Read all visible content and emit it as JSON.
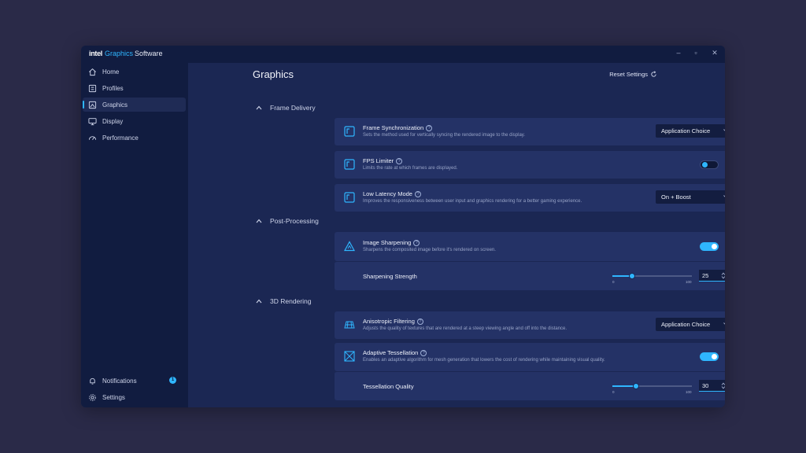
{
  "app": {
    "brand_intel": "intel",
    "brand_graphics": "Graphics",
    "brand_software": "Software"
  },
  "window_controls": {
    "minimize": "–",
    "maximize": "▫",
    "close": "✕"
  },
  "sidebar": {
    "items": [
      {
        "label": "Home",
        "icon": "home-icon"
      },
      {
        "label": "Profiles",
        "icon": "profiles-icon"
      },
      {
        "label": "Graphics",
        "icon": "graphics-icon",
        "active": true
      },
      {
        "label": "Display",
        "icon": "display-icon"
      },
      {
        "label": "Performance",
        "icon": "performance-icon"
      }
    ],
    "notifications": {
      "label": "Notifications",
      "badge": "1"
    },
    "settings": {
      "label": "Settings"
    }
  },
  "main": {
    "title": "Graphics",
    "reset_label": "Reset Settings"
  },
  "sections": {
    "frame_delivery": {
      "title": "Frame Delivery",
      "frame_sync": {
        "title": "Frame Synchronization",
        "desc": "Sets the method used for vertically syncing the rendered image to the display.",
        "value": "Application Choice"
      },
      "fps_limiter": {
        "title": "FPS Limiter",
        "desc": "Limits the rate at which frames are displayed.",
        "state": "Off"
      },
      "low_latency": {
        "title": "Low Latency Mode",
        "desc": "Improves the responsiveness between user input and graphics rendering for a better gaming experience.",
        "value": "On + Boost"
      }
    },
    "post_processing": {
      "title": "Post-Processing",
      "image_sharpening": {
        "title": "Image Sharpening",
        "desc": "Sharpens the composited image before it's rendered on screen.",
        "state": "On"
      },
      "sharpening_strength": {
        "label": "Sharpening Strength",
        "value": "25",
        "min": "0",
        "max": "100"
      }
    },
    "rendering_3d": {
      "title": "3D Rendering",
      "anisotropic": {
        "title": "Anisotropic Filtering",
        "desc": "Adjusts the quality of textures that are rendered at a steep viewing angle and off into the distance.",
        "value": "Application Choice"
      },
      "adaptive_tessellation": {
        "title": "Adaptive Tessellation",
        "desc": "Enables an adaptive algorithm for mesh generation that lowers the cost of rendering while maintaining visual quality.",
        "state": "On"
      },
      "tessellation_quality": {
        "label": "Tessellation Quality",
        "value": "30",
        "min": "0",
        "max": "100"
      }
    }
  },
  "help_glyph": "?",
  "colors": {
    "accent": "#2fb6ff",
    "window_bg": "#1b2753",
    "sidebar_bg": "#111c40",
    "card_bg": "#243266",
    "page_bg": "#2a2a48"
  }
}
